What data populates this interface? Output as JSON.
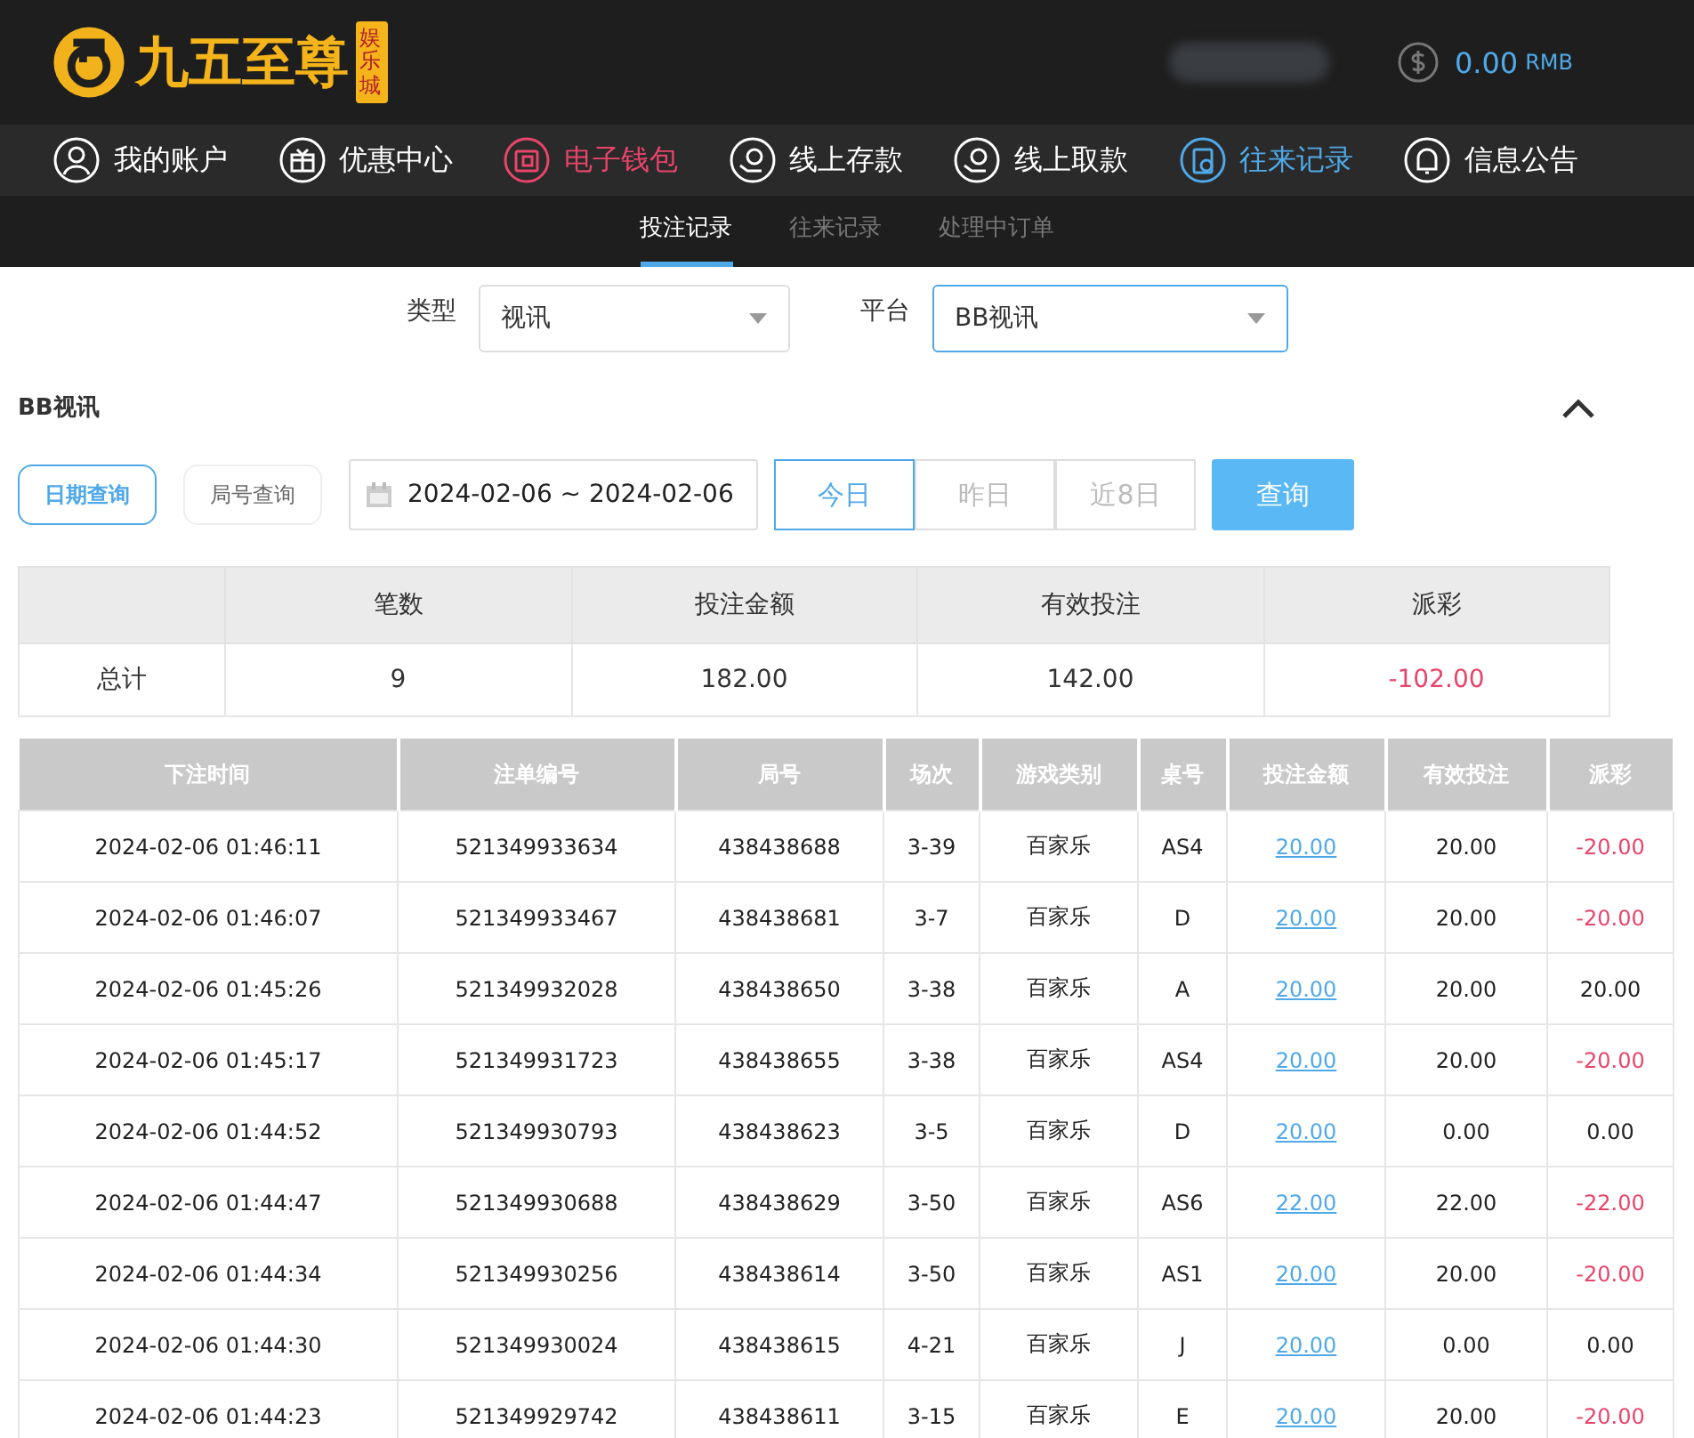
{
  "brand": {
    "name": "九五至尊",
    "tag": "娱乐城"
  },
  "balance": {
    "amount": "0.00",
    "currency": "RMB"
  },
  "nav": [
    {
      "label": "我的账户",
      "kind": "user",
      "color": "#ffffff"
    },
    {
      "label": "优惠中心",
      "kind": "gift",
      "color": "#ffffff"
    },
    {
      "label": "电子钱包",
      "kind": "wallet",
      "color": "#e8456b"
    },
    {
      "label": "线上存款",
      "kind": "deposit",
      "color": "#ffffff"
    },
    {
      "label": "线上取款",
      "kind": "withdraw",
      "color": "#ffffff"
    },
    {
      "label": "往来记录",
      "kind": "records",
      "color": "#4fa9e8"
    },
    {
      "label": "信息公告",
      "kind": "bell",
      "color": "#ffffff"
    }
  ],
  "subtabs": [
    {
      "label": "投注记录",
      "selected": true
    },
    {
      "label": "往来记录",
      "selected": false
    },
    {
      "label": "处理中订单",
      "selected": false
    }
  ],
  "filters": [
    {
      "label": "类型",
      "value": "视讯",
      "focused": false
    },
    {
      "label": "平台",
      "value": "BB视讯",
      "focused": true
    }
  ],
  "section_title": "BB视讯",
  "query_modes": [
    {
      "label": "日期查询",
      "selected": true
    },
    {
      "label": "局号查询",
      "selected": false
    }
  ],
  "date_range": "2024-02-06 ~ 2024-02-06",
  "quick_ranges": [
    {
      "label": "今日",
      "selected": true
    },
    {
      "label": "昨日",
      "selected": false
    },
    {
      "label": "近8日",
      "selected": false
    }
  ],
  "query_button": "查询",
  "summary": {
    "columns": [
      "笔数",
      "投注金额",
      "有效投注",
      "派彩"
    ],
    "label": "总计",
    "values": [
      "9",
      "182.00",
      "142.00",
      "-102.00"
    ],
    "payout_loss": true
  },
  "table": {
    "columns": [
      "下注时间",
      "注单编号",
      "局号",
      "场次",
      "游戏类别",
      "桌号",
      "投注金额",
      "有效投注",
      "派彩"
    ],
    "rows": [
      {
        "cells": [
          "2024-02-06 01:46:11",
          "521349933634",
          "438438688",
          "3-39",
          "百家乐",
          "AS4",
          "20.00",
          "20.00",
          "-20.00"
        ],
        "loss": true
      },
      {
        "cells": [
          "2024-02-06 01:46:07",
          "521349933467",
          "438438681",
          "3-7",
          "百家乐",
          "D",
          "20.00",
          "20.00",
          "-20.00"
        ],
        "loss": true
      },
      {
        "cells": [
          "2024-02-06 01:45:26",
          "521349932028",
          "438438650",
          "3-38",
          "百家乐",
          "A",
          "20.00",
          "20.00",
          "20.00"
        ],
        "loss": false
      },
      {
        "cells": [
          "2024-02-06 01:45:17",
          "521349931723",
          "438438655",
          "3-38",
          "百家乐",
          "AS4",
          "20.00",
          "20.00",
          "-20.00"
        ],
        "loss": true
      },
      {
        "cells": [
          "2024-02-06 01:44:52",
          "521349930793",
          "438438623",
          "3-5",
          "百家乐",
          "D",
          "20.00",
          "0.00",
          "0.00"
        ],
        "loss": false
      },
      {
        "cells": [
          "2024-02-06 01:44:47",
          "521349930688",
          "438438629",
          "3-50",
          "百家乐",
          "AS6",
          "22.00",
          "22.00",
          "-22.00"
        ],
        "loss": true
      },
      {
        "cells": [
          "2024-02-06 01:44:34",
          "521349930256",
          "438438614",
          "3-50",
          "百家乐",
          "AS1",
          "20.00",
          "20.00",
          "-20.00"
        ],
        "loss": true
      },
      {
        "cells": [
          "2024-02-06 01:44:30",
          "521349930024",
          "438438615",
          "4-21",
          "百家乐",
          "J",
          "20.00",
          "0.00",
          "0.00"
        ],
        "loss": false
      },
      {
        "cells": [
          "2024-02-06 01:44:23",
          "521349929742",
          "438438611",
          "3-15",
          "百家乐",
          "E",
          "20.00",
          "20.00",
          "-20.00"
        ],
        "loss": true
      }
    ]
  }
}
